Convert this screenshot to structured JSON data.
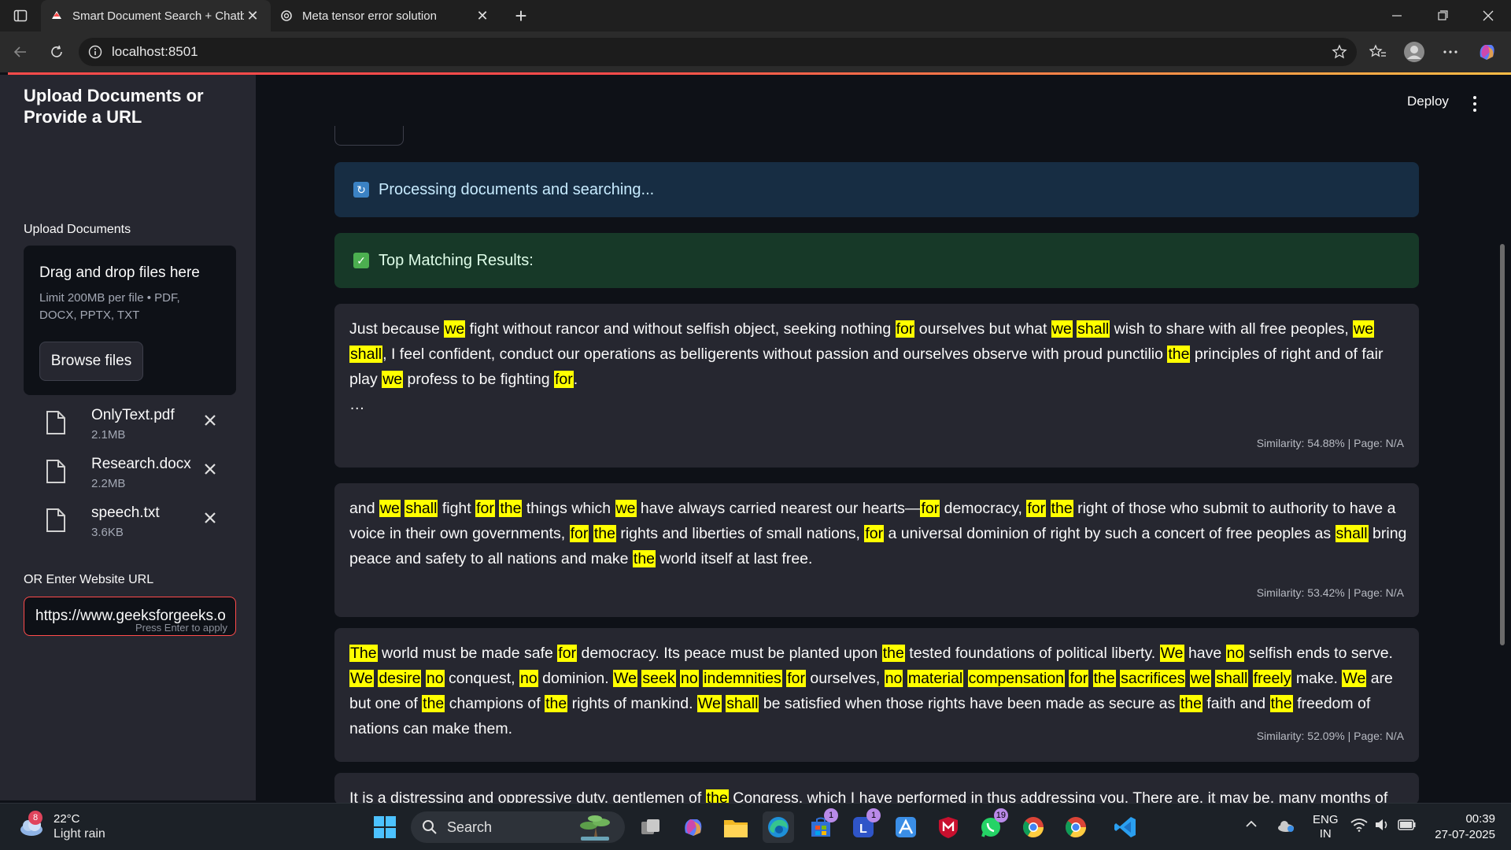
{
  "browser": {
    "tabs": [
      {
        "title": "Smart Document Search + Chatbot",
        "active": true
      },
      {
        "title": "Meta tensor error solution",
        "active": false
      }
    ],
    "url": "localhost:8501"
  },
  "app_header": {
    "deploy_label": "Deploy"
  },
  "sidebar": {
    "title": "Upload Documents or Provide a URL",
    "upload_label": "Upload Documents",
    "dropzone": {
      "title": "Drag and drop files here",
      "limit": "Limit 200MB per file • PDF, DOCX, PPTX, TXT",
      "browse_label": "Browse files"
    },
    "files": [
      {
        "name": "OnlyText.pdf",
        "size": "2.1MB"
      },
      {
        "name": "Research.docx",
        "size": "2.2MB"
      },
      {
        "name": "speech.txt",
        "size": "3.6KB"
      }
    ],
    "url_label": "OR Enter Website URL",
    "url_value": "https://www.geeksforgeeks.o",
    "url_hint": "Press Enter to apply"
  },
  "main": {
    "status_info": "Processing documents and searching...",
    "status_success": "Top Matching Results:",
    "results": [
      {
        "similarity": "Similarity: 54.88% | Page: N/A",
        "ellipsis": "…"
      },
      {
        "similarity": "Similarity: 53.42% | Page: N/A"
      },
      {
        "similarity": "Similarity: 52.09% | Page: N/A"
      }
    ]
  },
  "taskbar": {
    "weather_temp": "22°C",
    "weather_desc": "Light rain",
    "weather_badge": "8",
    "search_label": "Search",
    "badges": {
      "store": "1",
      "l_app": "1",
      "whatsapp": "19"
    },
    "lang_1": "ENG",
    "lang_2": "IN",
    "time": "00:39",
    "date": "27-07-2025"
  },
  "colors": {
    "accent": "#ff4b4b",
    "highlight": "#ffff00",
    "info_bg": "#172d43",
    "success_bg": "#173928"
  }
}
